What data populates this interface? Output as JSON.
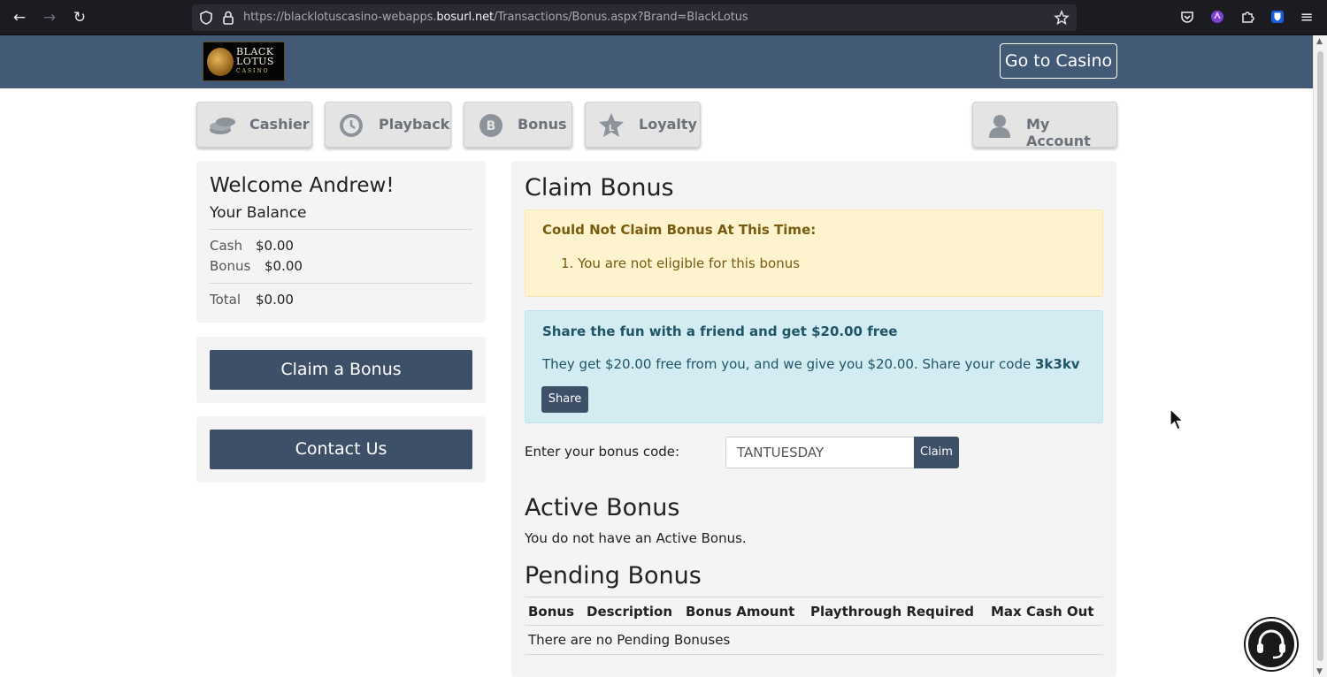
{
  "browser": {
    "url_prefix": "https://blacklotuscasino-webapps.",
    "url_host": "bosurl.net",
    "url_path": "/Transactions/Bonus.aspx?Brand=BlackLotus"
  },
  "header": {
    "logo_line1": "BLACK",
    "logo_line2": "LOTUS",
    "logo_line3": "CASINO",
    "go_casino_label": "Go to Casino"
  },
  "tabs": [
    {
      "label": "Cashier",
      "icon": "coins-icon"
    },
    {
      "label": "Playback",
      "icon": "history-icon"
    },
    {
      "label": "Bonus",
      "icon": "bonus-b-icon"
    },
    {
      "label": "Loyalty",
      "icon": "star-icon"
    },
    {
      "label": "My Account",
      "icon": "user-icon"
    }
  ],
  "sidebar": {
    "welcome": "Welcome Andrew!",
    "balance_title": "Your Balance",
    "cash_label": "Cash",
    "cash_value": "$0.00",
    "bonus_label": "Bonus",
    "bonus_value": "$0.00",
    "total_label": "Total",
    "total_value": "$0.00",
    "claim_bonus_button": "Claim a Bonus",
    "contact_us_button": "Contact Us"
  },
  "main": {
    "claim_title": "Claim Bonus",
    "warning_title": "Could Not Claim Bonus At This Time:",
    "warning_item": "1. You are not eligible for this bonus",
    "share_title": "Share the fun with a friend and get $20.00 free",
    "share_text": "They get $20.00 free from you, and we give you $20.00. Share your code ",
    "share_code": "3k3kv",
    "share_button": "Share",
    "code_label": "Enter your bonus code:",
    "code_value": "TANTUESDAY",
    "claim_button": "Claim",
    "active_title": "Active Bonus",
    "active_text": "You do not have an Active Bonus.",
    "pending_title": "Pending Bonus",
    "pending_columns": [
      "Bonus",
      "Description",
      "Bonus Amount",
      "Playthrough Required",
      "Max Cash Out"
    ],
    "pending_empty": "There are no Pending Bonuses"
  },
  "colors": {
    "header_bg": "#435a77",
    "button_bg": "#3d5068",
    "warning_bg": "#fdf3cf",
    "info_bg": "#d3ecf1"
  }
}
